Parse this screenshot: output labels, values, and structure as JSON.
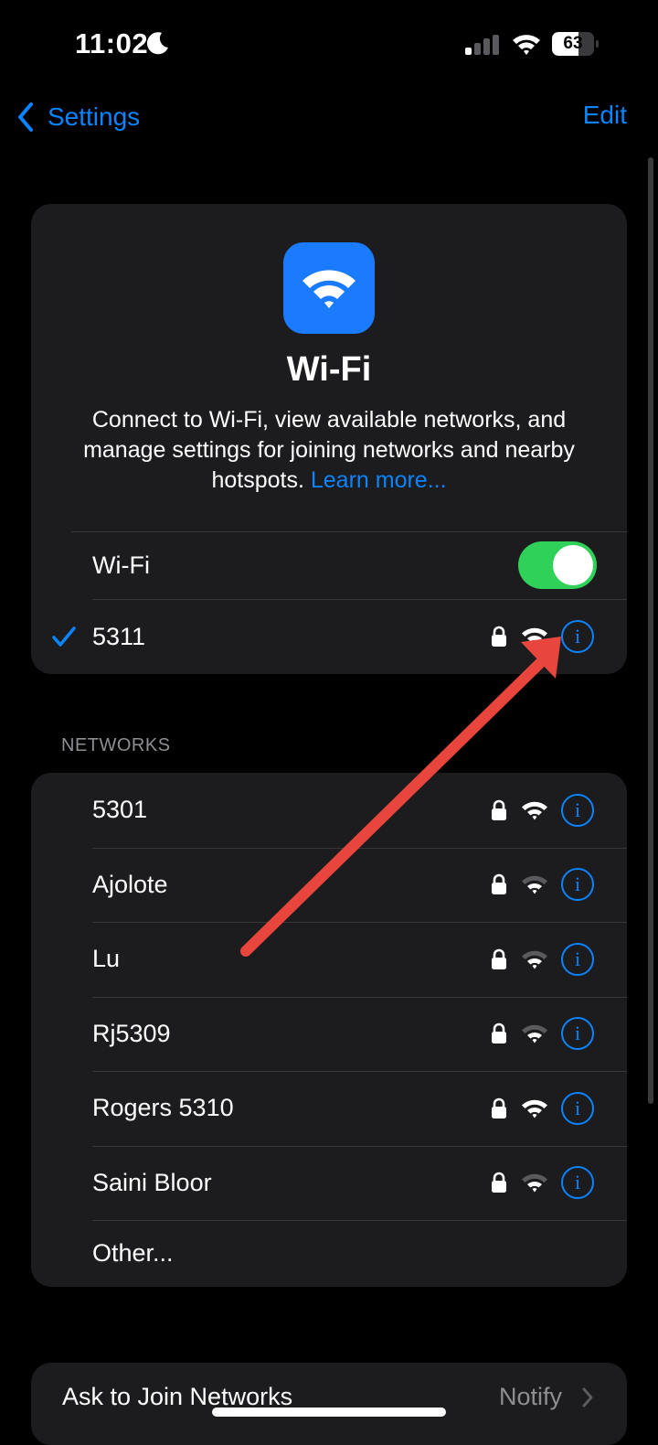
{
  "status_bar": {
    "time": "11:02",
    "battery_level": "63",
    "battery_fraction": 0.63,
    "icons": [
      "moon-icon",
      "cellular-signal-icon",
      "wifi-status-icon",
      "battery-icon"
    ]
  },
  "nav": {
    "back_label": "Settings",
    "edit_label": "Edit"
  },
  "wifi_card": {
    "title": "Wi-Fi",
    "description": "Connect to Wi-Fi, view available networks, and manage settings for joining networks and nearby hotspots.",
    "learn_more": "Learn more...",
    "toggle_label": "Wi-Fi",
    "toggle_on": true,
    "connected_network": "5311"
  },
  "networks": {
    "header": "NETWORKS",
    "items": [
      {
        "name": "5301",
        "signal": "strong"
      },
      {
        "name": "Ajolote",
        "signal": "weak"
      },
      {
        "name": "Lu",
        "signal": "weak"
      },
      {
        "name": "Rj5309",
        "signal": "weak"
      },
      {
        "name": "Rogers 5310",
        "signal": "strong"
      },
      {
        "name": "Saini Bloor",
        "signal": "weak"
      }
    ],
    "other_label": "Other..."
  },
  "ask_to_join": {
    "label": "Ask to Join Networks",
    "value": "Notify"
  },
  "colors": {
    "accent": "#0a84ff",
    "toggle_on": "#30d158",
    "annotation_arrow": "#e8453c",
    "card": "#1c1c1e",
    "background": "#000000"
  }
}
